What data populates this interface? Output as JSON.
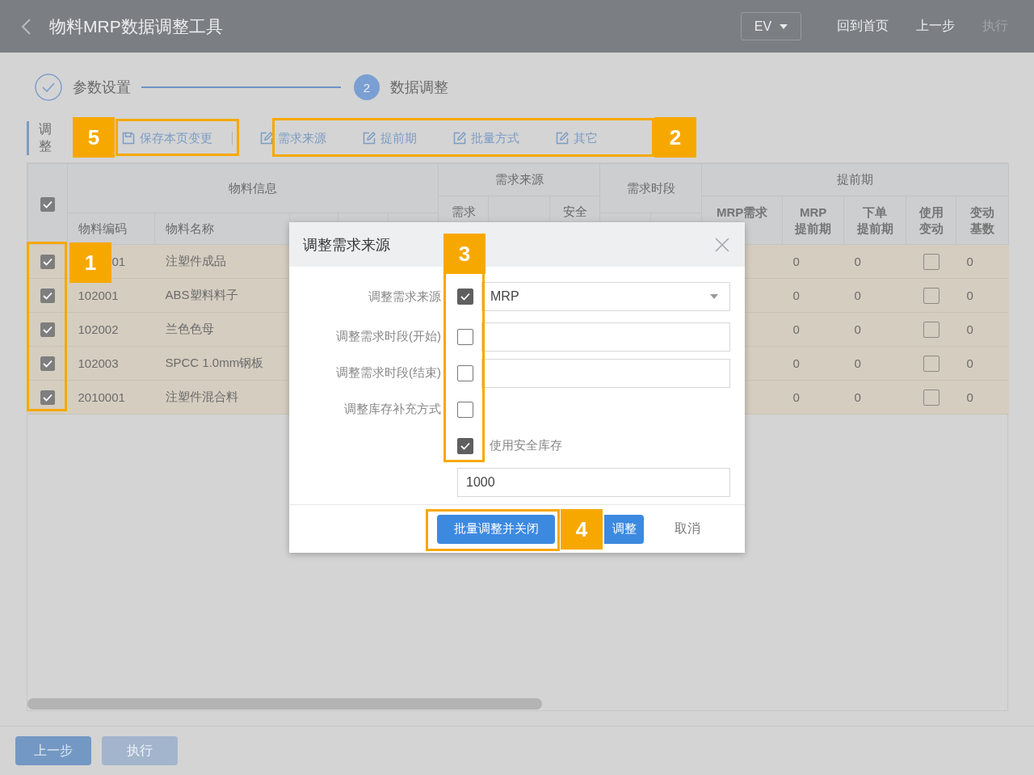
{
  "window": {
    "title": "物料MRP数据调整工具"
  },
  "header_actions": [
    {
      "label": "EV",
      "kind": "dropdown"
    },
    {
      "label": "回到首页",
      "kind": "link",
      "disabled": false
    },
    {
      "label": "上一步",
      "kind": "link",
      "disabled": false
    },
    {
      "label": "执行",
      "kind": "link",
      "disabled": true
    }
  ],
  "steps": [
    {
      "label": "参数设置",
      "done": true
    },
    {
      "label": "数据调整",
      "done": false,
      "number": "2"
    }
  ],
  "toolbar": {
    "label": "调整",
    "save_button": "保存本页变更",
    "edit_buttons": [
      "需求来源",
      "提前期",
      "批量方式",
      "其它"
    ]
  },
  "table": {
    "all_selected": true,
    "groups": [
      {
        "label": "物料信息"
      },
      {
        "label": "需求来源"
      },
      {
        "label": "需求时段"
      },
      {
        "label": "提前期"
      }
    ],
    "info_columns": [
      "物料编码",
      "物料名称"
    ],
    "source_columns": [
      "需求",
      "安全"
    ],
    "lead_columns": [
      [
        "MRP需求"
      ],
      [
        "MRP",
        "提前期"
      ],
      [
        "下单",
        "提前期"
      ],
      [
        "使用",
        "变动"
      ],
      [
        "变动",
        "基数"
      ]
    ],
    "rows": [
      {
        "selected": true,
        "code": "01",
        "code_covered": true,
        "name": "注塑件成品",
        "mrp_lead": "0",
        "order_lead": "0",
        "use_change": false,
        "change_base": "0"
      },
      {
        "selected": true,
        "code": "102001",
        "code_covered": false,
        "name": "ABS塑料料子",
        "mrp_lead": "0",
        "order_lead": "0",
        "use_change": false,
        "change_base": "0"
      },
      {
        "selected": true,
        "code": "102002",
        "code_covered": false,
        "name": "兰色色母",
        "mrp_lead": "0",
        "order_lead": "0",
        "use_change": false,
        "change_base": "0"
      },
      {
        "selected": true,
        "code": "102003",
        "code_covered": false,
        "name": "SPCC 1.0mm钢板",
        "mrp_lead": "0",
        "order_lead": "0",
        "use_change": false,
        "change_base": "0"
      },
      {
        "selected": true,
        "code": "2010001",
        "code_covered": false,
        "name": "注塑件混合料",
        "mrp_lead": "0",
        "order_lead": "0",
        "use_change": false,
        "change_base": "0"
      }
    ]
  },
  "footer_buttons": [
    {
      "label": "上一步",
      "disabled": false
    },
    {
      "label": "执行",
      "disabled": true
    }
  ],
  "modal": {
    "title": "调整需求来源",
    "fields": [
      {
        "label": "调整需求来源",
        "checked": true,
        "kind": "select",
        "value": "MRP"
      },
      {
        "label": "调整需求时段(开始)",
        "checked": false,
        "kind": "input"
      },
      {
        "label": "调整需求时段(结束)",
        "checked": false,
        "kind": "input"
      },
      {
        "label": "调整库存补充方式",
        "checked": false,
        "kind": "none"
      },
      {
        "label": "使用安全库存",
        "checked": true,
        "kind": "check"
      }
    ],
    "safety_stock": "1000",
    "buttons": [
      {
        "label": "批量调整并关闭",
        "kind": "primary"
      },
      {
        "label": "调整",
        "kind": "primary"
      },
      {
        "label": "取消",
        "kind": "text"
      }
    ]
  },
  "callouts": [
    {
      "number": "1"
    },
    {
      "number": "2"
    },
    {
      "number": "3"
    },
    {
      "number": "4"
    },
    {
      "number": "5"
    }
  ]
}
